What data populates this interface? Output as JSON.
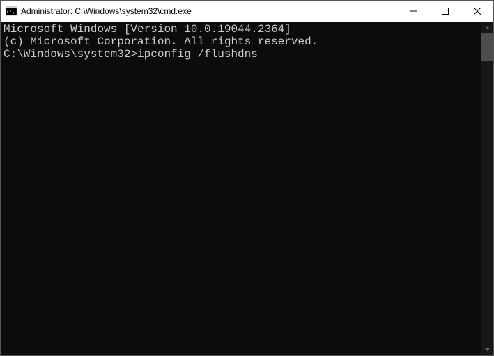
{
  "window": {
    "title": "Administrator: C:\\Windows\\system32\\cmd.exe"
  },
  "terminal": {
    "line1": "Microsoft Windows [Version 10.0.19044.2364]",
    "line2": "(c) Microsoft Corporation. All rights reserved.",
    "blank": "",
    "prompt": "C:\\Windows\\system32>",
    "command": "ipconfig /flushdns"
  }
}
